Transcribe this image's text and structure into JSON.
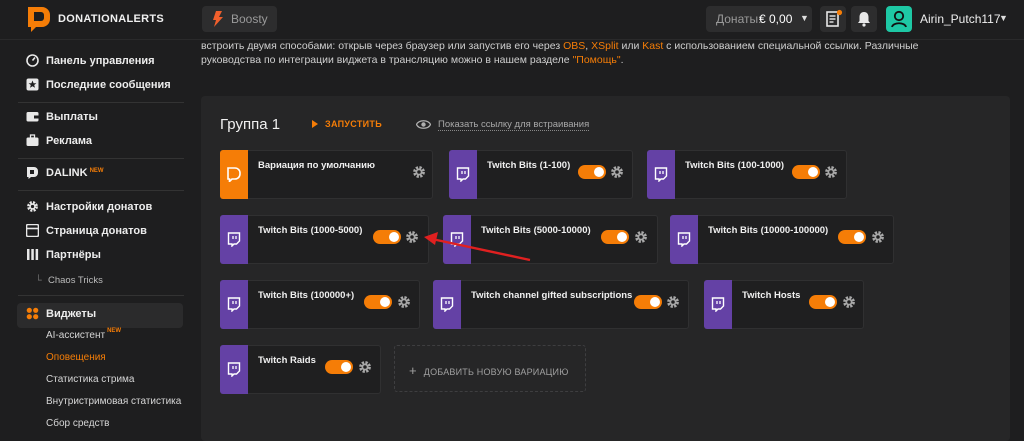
{
  "header": {
    "brand": "DONATIONALERTS",
    "boosty_label": "Boosty",
    "donates_label": "Донаты:",
    "donates_value": "€ 0,00",
    "username": "Airin_Putch117"
  },
  "sidebar": {
    "items": [
      {
        "label": "Панель управления",
        "icon": "dashboard-icon"
      },
      {
        "label": "Последние сообщения",
        "icon": "star-icon"
      },
      {
        "label": "Выплаты",
        "icon": "wallet-icon"
      },
      {
        "label": "Реклама",
        "icon": "briefcase-icon"
      },
      {
        "label": "DALINK",
        "icon": "dalink-icon",
        "badge": "NEW"
      },
      {
        "label": "Настройки донатов",
        "icon": "gear-icon"
      },
      {
        "label": "Страница донатов",
        "icon": "page-icon"
      },
      {
        "label": "Партнёры",
        "icon": "partners-icon"
      },
      {
        "label": "Виджеты",
        "icon": "widgets-icon"
      }
    ],
    "partners_sub": "Chaos Tricks",
    "widget_subs": [
      {
        "label": "AI-ассистент",
        "badge": "NEW"
      },
      {
        "label": "Оповещения"
      },
      {
        "label": "Статистика стрима"
      },
      {
        "label": "Внутристримовая статистика"
      },
      {
        "label": "Сбор средств"
      }
    ]
  },
  "intro": {
    "part1": "встроить двумя способами: открыв через браузер или запустив его через ",
    "link_obs": "OBS",
    "sep1": ", ",
    "link_xsplit": "XSplit",
    "sep2": " или ",
    "link_kast": "Kast",
    "part2": " с использованием специальной ссылки. Различные руководства по интеграции виджета в трансляцию можно в нашем разделе ",
    "link_help": "\"Помощь\"",
    "end": "."
  },
  "group": {
    "title": "Группа 1",
    "launch_label": "ЗАПУСТИТЬ",
    "embed_label": "Показать ссылку для встраивания",
    "add_variation_label": "ДОБАВИТЬ НОВУЮ ВАРИАЦИЮ"
  },
  "variations": [
    {
      "name": "Вариация по умолчанию",
      "enabled": true
    },
    {
      "name": "Twitch Bits (1-100)",
      "enabled": true
    },
    {
      "name": "Twitch Bits (100-1000)",
      "enabled": true
    },
    {
      "name": "Twitch Bits (1000-5000)",
      "enabled": true
    },
    {
      "name": "Twitch Bits (5000-10000)",
      "enabled": true
    },
    {
      "name": "Twitch Bits (10000-100000)",
      "enabled": true
    },
    {
      "name": "Twitch Bits (100000+)",
      "enabled": true
    },
    {
      "name": "Twitch channel gifted subscriptions",
      "enabled": true
    },
    {
      "name": "Twitch Hosts",
      "enabled": true
    },
    {
      "name": "Twitch Raids",
      "enabled": true
    }
  ],
  "colors": {
    "accent": "#f57d07",
    "twitch": "#6441a5",
    "avatar": "#1ec8a5",
    "annotation_arrow": "#e02020"
  }
}
